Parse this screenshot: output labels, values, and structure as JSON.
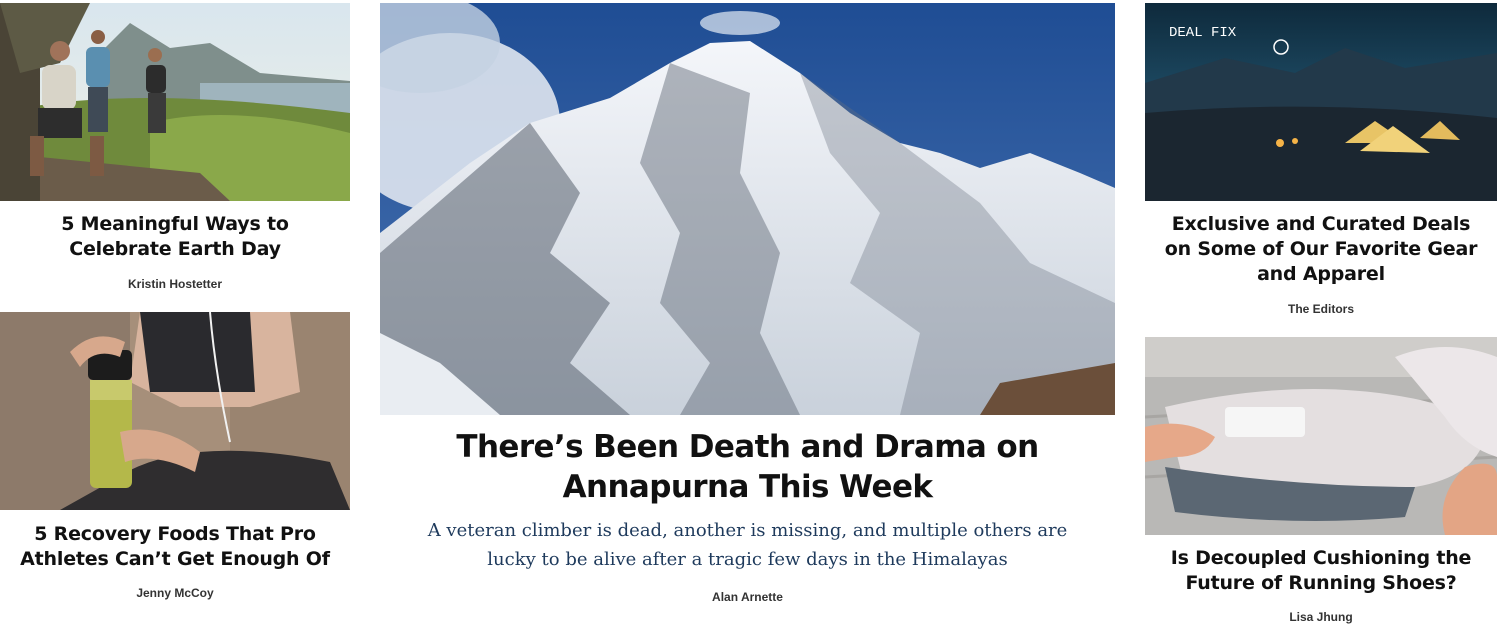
{
  "articles": {
    "earth_day": {
      "title": "5 Meaningful Ways to Celebrate Earth Day",
      "author": "Kristin Hostetter",
      "image": "hikers-on-cliff-overlooking-ocean"
    },
    "recovery_foods": {
      "title": "5 Recovery Foods That Pro Athletes Can’t Get Enough Of",
      "author": "Jenny McCoy",
      "image": "woman-holding-green-smoothie-shaker"
    },
    "annapurna": {
      "title": "There’s Been Death and Drama on Annapurna This Week",
      "dek": "A veteran climber is dead, another is missing, and multiple others are lucky to be alive after a tragic few days in the Himalayas",
      "author": "Alan Arnette",
      "image": "snow-covered-annapurna-peak"
    },
    "deal_fix": {
      "title": "Exclusive and Curated Deals on Some of Our Favorite Gear and Apparel",
      "author": "The Editors",
      "image": "campsite-tents-at-night",
      "badge": "DEAL FIX"
    },
    "cushioning": {
      "title": "Is Decoupled Cushioning the Future of Running Shoes?",
      "author": "Lisa Jhung",
      "image": "hands-bending-running-shoe-sole"
    }
  },
  "colors": {
    "headline": "#111111",
    "byline": "#333333",
    "dek": "#1e3a5c",
    "sky": "#2a4f8c"
  }
}
